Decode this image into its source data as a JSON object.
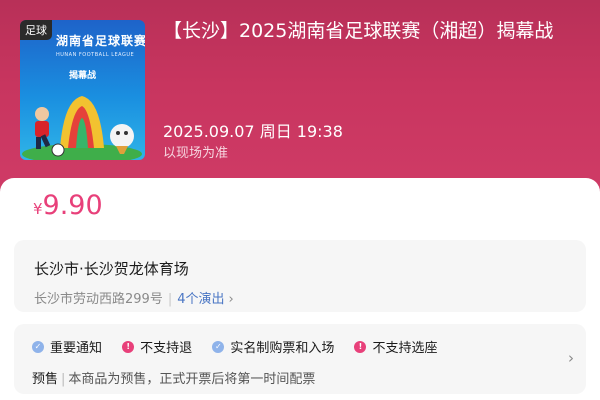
{
  "poster": {
    "tag": "足球",
    "title": "湖南省足球联赛",
    "subtitle": "HUNAN FOOTBALL LEAGUE",
    "kicker": "揭幕战",
    "art_icon": "soccer-player-mascot-illustration"
  },
  "event": {
    "title": "【长沙】2025湖南省足球联赛（湘超）揭幕战",
    "datetime": "2025.09.07 周日 19:38",
    "time_note": "以现场为准"
  },
  "price": {
    "symbol": "¥",
    "value": "9.90"
  },
  "venue": {
    "name": "长沙市·长沙贺龙体育场",
    "address": "长沙市劳动西路299号",
    "shows": "4个演出",
    "chevron": "›"
  },
  "notices": {
    "tags": [
      {
        "label": "重要通知",
        "icon": "check-icon"
      },
      {
        "label": "不支持退",
        "icon": "alert-icon"
      },
      {
        "label": "实名制购票和入场",
        "icon": "check-icon"
      },
      {
        "label": "不支持选座",
        "icon": "alert-icon"
      }
    ],
    "presale_label": "预售",
    "presale_text": "本商品为预售，正式开票后将第一时间配票",
    "chevron": "›"
  },
  "colors": {
    "header_bg": "#c8355f",
    "price": "#e8407a",
    "link": "#4a76c4"
  }
}
